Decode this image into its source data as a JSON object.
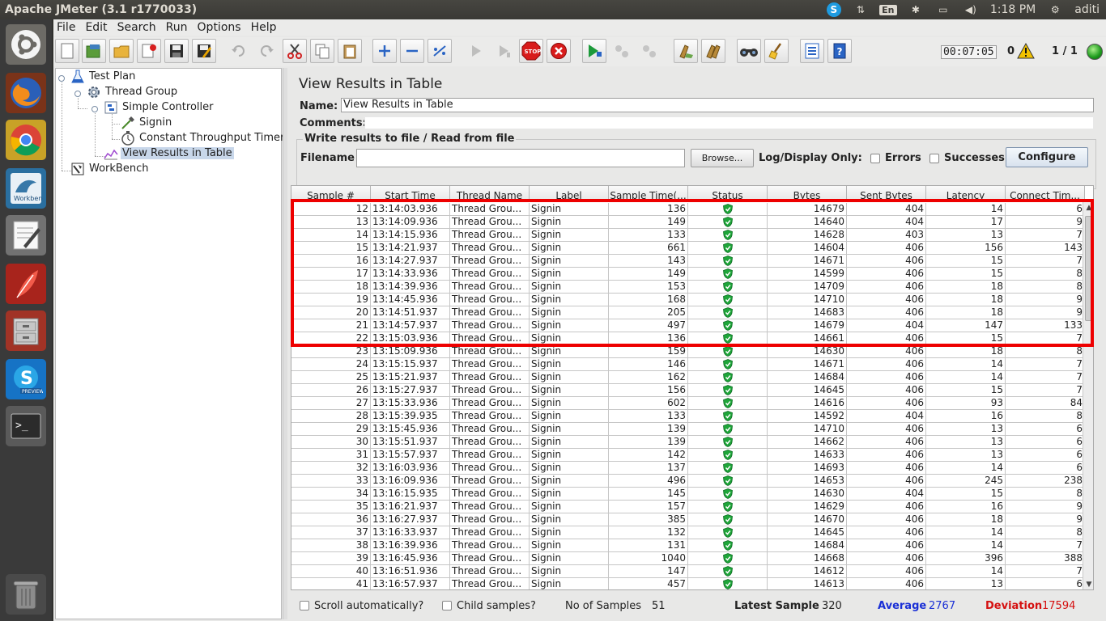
{
  "window": {
    "title": "Apache JMeter (3.1 r1770033)"
  },
  "system_tray": {
    "keyboard": "En",
    "time": "1:18 PM",
    "user": "aditi"
  },
  "menu": [
    "File",
    "Edit",
    "Search",
    "Run",
    "Options",
    "Help"
  ],
  "toolbar_status": {
    "elapsed": "00:07:05",
    "warnings": "0",
    "threads": "1 / 1"
  },
  "tree": {
    "test_plan": "Test Plan",
    "thread_group": "Thread Group",
    "simple_controller": "Simple Controller",
    "signin": "Signin",
    "timer": "Constant Throughput Timer",
    "results": "View Results in Table",
    "workbench": "WorkBench"
  },
  "panel": {
    "title": "View Results in Table",
    "name_label": "Name:",
    "name_value": "View Results in Table",
    "comments_label": "Comments:",
    "file_section": "Write results to file / Read from file",
    "filename_label": "Filename",
    "browse": "Browse...",
    "log_display": "Log/Display Only:",
    "errors": "Errors",
    "successes": "Successes",
    "configure": "Configure"
  },
  "table": {
    "columns": [
      "Sample #",
      "Start Time",
      "Thread Name",
      "Label",
      "Sample Time(...",
      "Status",
      "Bytes",
      "Sent Bytes",
      "Latency",
      "Connect Tim..."
    ],
    "rows": [
      [
        "12",
        "13:14:03.936",
        "Thread Grou...",
        "Signin",
        "136",
        "ok",
        "14679",
        "404",
        "14",
        "6"
      ],
      [
        "13",
        "13:14:09.936",
        "Thread Grou...",
        "Signin",
        "149",
        "ok",
        "14640",
        "404",
        "17",
        "9"
      ],
      [
        "14",
        "13:14:15.936",
        "Thread Grou...",
        "Signin",
        "133",
        "ok",
        "14628",
        "403",
        "13",
        "7"
      ],
      [
        "15",
        "13:14:21.937",
        "Thread Grou...",
        "Signin",
        "661",
        "ok",
        "14604",
        "406",
        "156",
        "143"
      ],
      [
        "16",
        "13:14:27.937",
        "Thread Grou...",
        "Signin",
        "143",
        "ok",
        "14671",
        "406",
        "15",
        "7"
      ],
      [
        "17",
        "13:14:33.936",
        "Thread Grou...",
        "Signin",
        "149",
        "ok",
        "14599",
        "406",
        "15",
        "8"
      ],
      [
        "18",
        "13:14:39.936",
        "Thread Grou...",
        "Signin",
        "153",
        "ok",
        "14709",
        "406",
        "18",
        "8"
      ],
      [
        "19",
        "13:14:45.936",
        "Thread Grou...",
        "Signin",
        "168",
        "ok",
        "14710",
        "406",
        "18",
        "9"
      ],
      [
        "20",
        "13:14:51.937",
        "Thread Grou...",
        "Signin",
        "205",
        "ok",
        "14683",
        "406",
        "18",
        "9"
      ],
      [
        "21",
        "13:14:57.937",
        "Thread Grou...",
        "Signin",
        "497",
        "ok",
        "14679",
        "404",
        "147",
        "133"
      ],
      [
        "22",
        "13:15:03.936",
        "Thread Grou...",
        "Signin",
        "136",
        "ok",
        "14661",
        "406",
        "15",
        "7"
      ],
      [
        "23",
        "13:15:09.936",
        "Thread Grou...",
        "Signin",
        "159",
        "ok",
        "14630",
        "406",
        "18",
        "8"
      ],
      [
        "24",
        "13:15:15.937",
        "Thread Grou...",
        "Signin",
        "146",
        "ok",
        "14671",
        "406",
        "14",
        "7"
      ],
      [
        "25",
        "13:15:21.937",
        "Thread Grou...",
        "Signin",
        "162",
        "ok",
        "14684",
        "406",
        "14",
        "7"
      ],
      [
        "26",
        "13:15:27.937",
        "Thread Grou...",
        "Signin",
        "156",
        "ok",
        "14645",
        "406",
        "15",
        "7"
      ],
      [
        "27",
        "13:15:33.936",
        "Thread Grou...",
        "Signin",
        "602",
        "ok",
        "14616",
        "406",
        "93",
        "84"
      ],
      [
        "28",
        "13:15:39.935",
        "Thread Grou...",
        "Signin",
        "133",
        "ok",
        "14592",
        "404",
        "16",
        "8"
      ],
      [
        "29",
        "13:15:45.936",
        "Thread Grou...",
        "Signin",
        "139",
        "ok",
        "14710",
        "406",
        "13",
        "6"
      ],
      [
        "30",
        "13:15:51.937",
        "Thread Grou...",
        "Signin",
        "139",
        "ok",
        "14662",
        "406",
        "13",
        "6"
      ],
      [
        "31",
        "13:15:57.937",
        "Thread Grou...",
        "Signin",
        "142",
        "ok",
        "14633",
        "406",
        "13",
        "6"
      ],
      [
        "32",
        "13:16:03.936",
        "Thread Grou...",
        "Signin",
        "137",
        "ok",
        "14693",
        "406",
        "14",
        "6"
      ],
      [
        "33",
        "13:16:09.936",
        "Thread Grou...",
        "Signin",
        "496",
        "ok",
        "14653",
        "406",
        "245",
        "238"
      ],
      [
        "34",
        "13:16:15.935",
        "Thread Grou...",
        "Signin",
        "145",
        "ok",
        "14630",
        "404",
        "15",
        "8"
      ],
      [
        "35",
        "13:16:21.937",
        "Thread Grou...",
        "Signin",
        "157",
        "ok",
        "14629",
        "406",
        "16",
        "9"
      ],
      [
        "36",
        "13:16:27.937",
        "Thread Grou...",
        "Signin",
        "385",
        "ok",
        "14670",
        "406",
        "18",
        "9"
      ],
      [
        "37",
        "13:16:33.937",
        "Thread Grou...",
        "Signin",
        "132",
        "ok",
        "14645",
        "406",
        "14",
        "8"
      ],
      [
        "38",
        "13:16:39.936",
        "Thread Grou...",
        "Signin",
        "131",
        "ok",
        "14684",
        "406",
        "14",
        "7"
      ],
      [
        "39",
        "13:16:45.936",
        "Thread Grou...",
        "Signin",
        "1040",
        "ok",
        "14668",
        "406",
        "396",
        "388"
      ],
      [
        "40",
        "13:16:51.936",
        "Thread Grou...",
        "Signin",
        "147",
        "ok",
        "14612",
        "406",
        "14",
        "7"
      ],
      [
        "41",
        "13:16:57.937",
        "Thread Grou...",
        "Signin",
        "457",
        "ok",
        "14613",
        "406",
        "13",
        "6"
      ]
    ]
  },
  "footer": {
    "scroll_auto": "Scroll automatically?",
    "child_samples": "Child samples?",
    "no_samples_label": "No of Samples",
    "no_samples_value": "51",
    "latest_label": "Latest Sample",
    "latest_value": "320",
    "average_label": "Average",
    "average_value": "2767",
    "deviation_label": "Deviation",
    "deviation_value": "17594"
  },
  "colors": {
    "highlight": "#ee0000",
    "average": "#1a2fd6",
    "deviation": "#d51010",
    "status_ok": "#1fa63a"
  }
}
